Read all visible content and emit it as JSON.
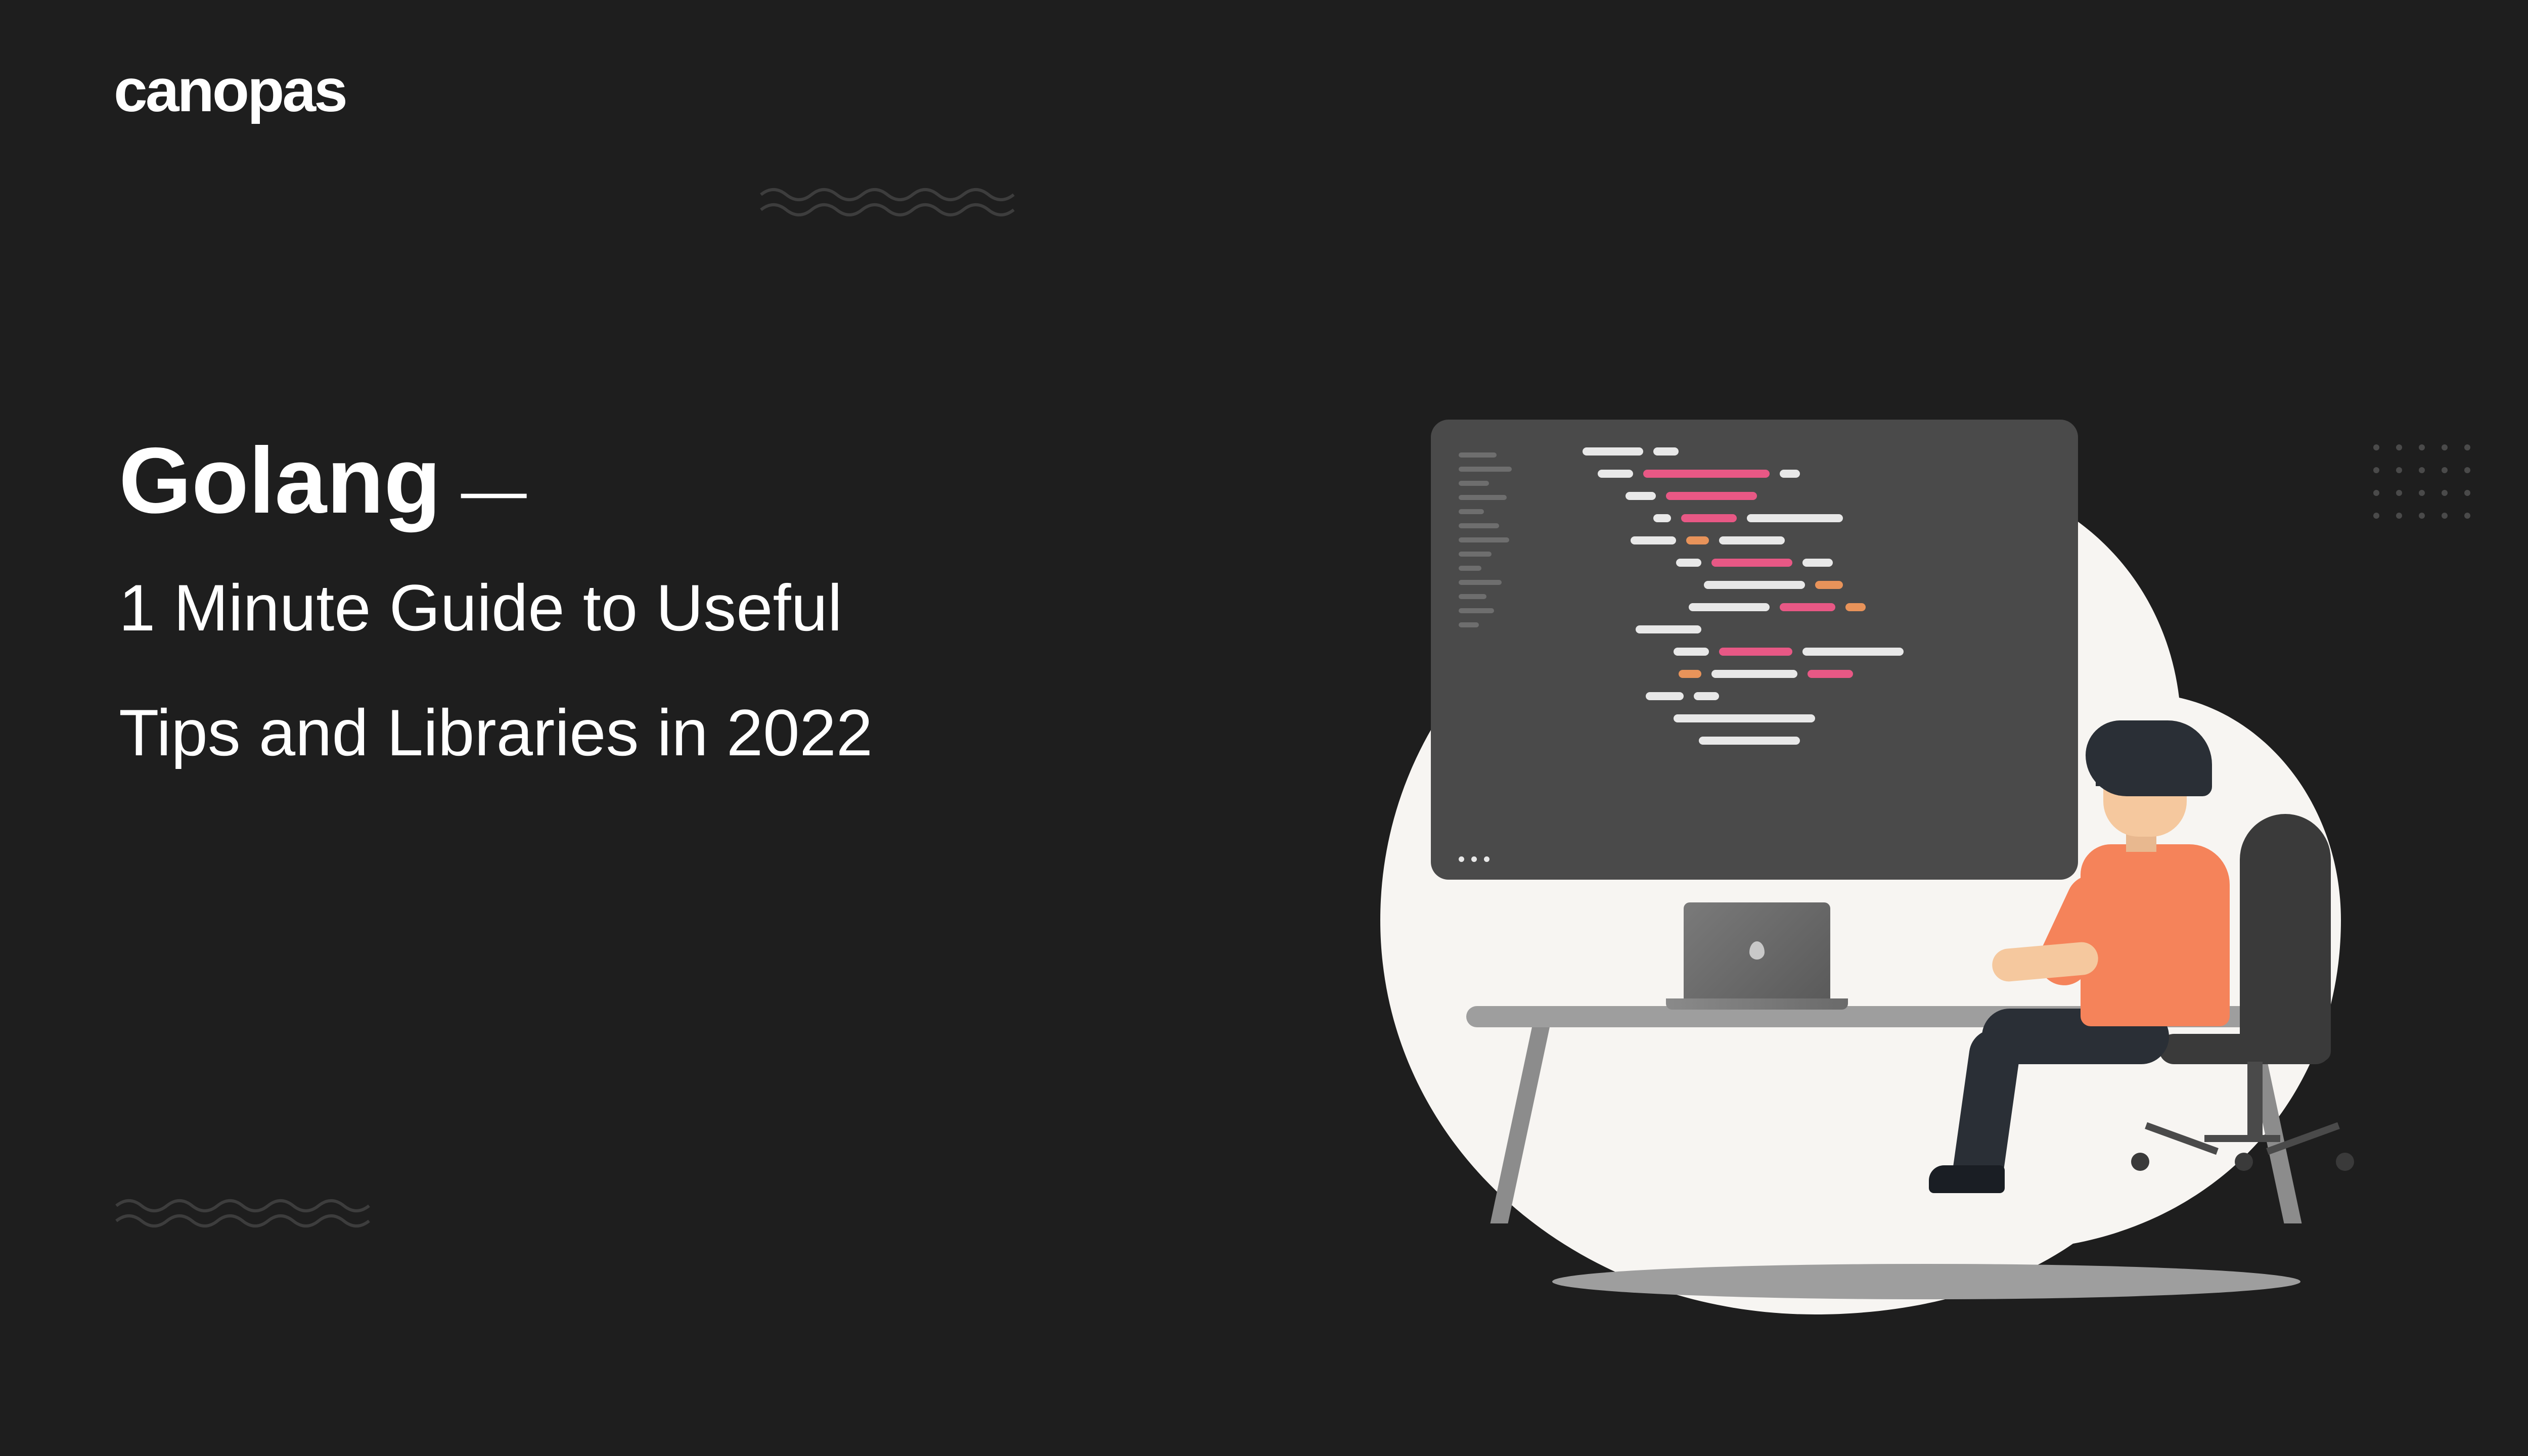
{
  "logo": {
    "text": "canopas"
  },
  "title": {
    "heading": "Golang",
    "dash": "—",
    "line1": "1 Minute Guide to Useful",
    "line2": "Tips and Libraries in 2022"
  }
}
